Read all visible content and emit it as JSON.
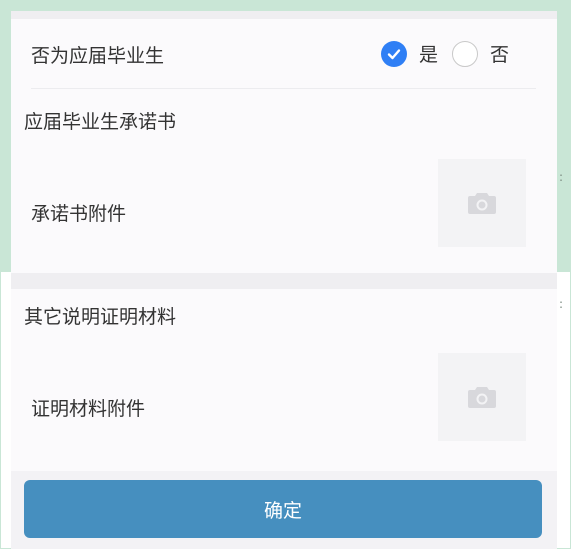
{
  "graduate_question": {
    "label": "否为应届毕业生",
    "options": [
      {
        "label": "是",
        "selected": true
      },
      {
        "label": "否",
        "selected": false
      }
    ]
  },
  "commitment_section": {
    "title": "应届毕业生承诺书",
    "attachment_label": "承诺书附件",
    "upload_icon": "camera-icon"
  },
  "proof_section": {
    "title": "其它说明证明材料",
    "attachment_label": "证明材料附件",
    "upload_icon": "camera-icon"
  },
  "footer": {
    "confirm_label": "确定"
  },
  "colors": {
    "accent_blue": "#2f7ff5",
    "button_blue": "#468fbf",
    "backdrop_green": "#c9e6d6"
  }
}
